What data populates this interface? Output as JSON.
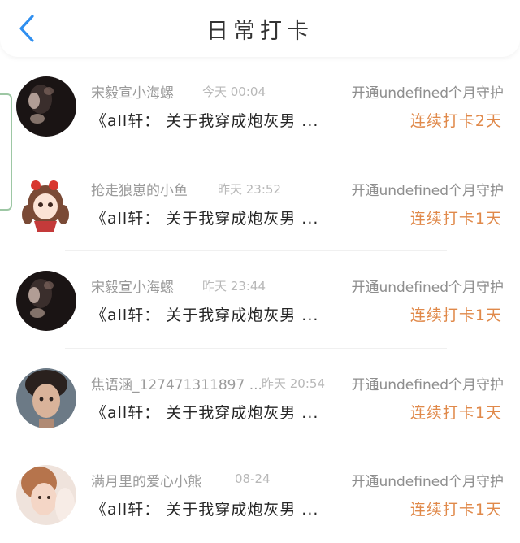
{
  "header": {
    "title": "日常打卡"
  },
  "colors": {
    "accent_blue": "#2f8ff0",
    "streak_orange": "#e0894a",
    "name_gray": "#9b9b9b",
    "time_gray": "#b8b8b8"
  },
  "checkins": [
    {
      "name": "宋毅宣小海螺",
      "time": "今天 00:04",
      "guard": "开通undefined个月守护",
      "book": "《all轩： 关于我穿成炮灰男 ...",
      "streak": "连续打卡2天",
      "avatar_icon": "dark-portrait-avatar"
    },
    {
      "name": "抢走狼崽的小鱼",
      "time": "昨天 23:52",
      "guard": "开通undefined个月守护",
      "book": "《all轩： 关于我穿成炮灰男 ...",
      "streak": "连续打卡1天",
      "avatar_icon": "cartoon-girl-avatar"
    },
    {
      "name": "宋毅宣小海螺",
      "time": "昨天 23:44",
      "guard": "开通undefined个月守护",
      "book": "《all轩： 关于我穿成炮灰男 ...",
      "streak": "连续打卡1天",
      "avatar_icon": "dark-portrait-avatar"
    },
    {
      "name": "焦语涵_127471311897 ...",
      "time": "昨天 20:54",
      "guard": "开通undefined个月守护",
      "book": "《all轩： 关于我穿成炮灰男 ...",
      "streak": "连续打卡1天",
      "avatar_icon": "photo-portrait-avatar"
    },
    {
      "name": "满月里的爱心小熊",
      "time": "08-24",
      "guard": "开通undefined个月守护",
      "book": "《all轩： 关于我穿成炮灰男 ...",
      "streak": "连续打卡1天",
      "avatar_icon": "photo-portrait-avatar"
    }
  ]
}
